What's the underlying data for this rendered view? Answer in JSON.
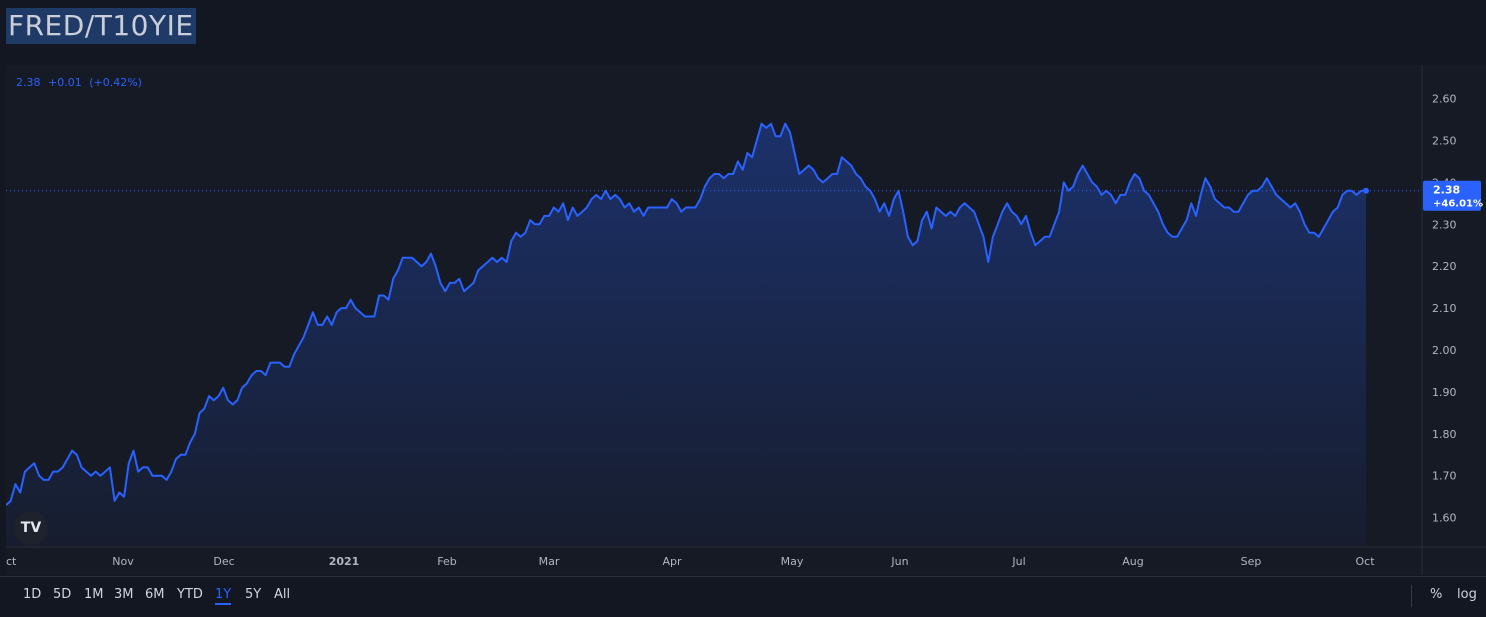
{
  "symbol": "FRED/T10YIE",
  "legend": {
    "value": "2.38",
    "change": "+0.01",
    "change_pct": "(+0.42%)"
  },
  "price_badge": {
    "value": "2.38",
    "pct": "+46.01%"
  },
  "logo_text": "TV",
  "ranges": [
    "1D",
    "5D",
    "1M",
    "3M",
    "6M",
    "YTD",
    "1Y",
    "5Y",
    "All"
  ],
  "active_range": "1Y",
  "scale_buttons": {
    "percent": "%",
    "log": "log"
  },
  "colors": {
    "line": "#2962ff",
    "background": "#131722",
    "badge": "#2962ff"
  },
  "chart_data": {
    "type": "area",
    "x_labels": [
      "Oct",
      "Nov",
      "Dec",
      "2021",
      "Feb",
      "Mar",
      "Apr",
      "May",
      "Jun",
      "Jul",
      "Aug",
      "Sep",
      "Oct"
    ],
    "x_label_shown_first": "ct",
    "y_ticks": [
      1.6,
      1.7,
      1.8,
      1.9,
      2.0,
      2.1,
      2.2,
      2.3,
      2.4,
      2.5,
      2.6
    ],
    "ylim": [
      1.53,
      2.68
    ],
    "current_value": 2.38,
    "grid": false,
    "values": [
      1.63,
      1.64,
      1.68,
      1.66,
      1.71,
      1.72,
      1.73,
      1.7,
      1.69,
      1.69,
      1.71,
      1.71,
      1.72,
      1.74,
      1.76,
      1.75,
      1.72,
      1.71,
      1.7,
      1.71,
      1.7,
      1.71,
      1.72,
      1.64,
      1.66,
      1.65,
      1.73,
      1.76,
      1.71,
      1.72,
      1.72,
      1.7,
      1.7,
      1.7,
      1.69,
      1.71,
      1.74,
      1.75,
      1.75,
      1.78,
      1.8,
      1.85,
      1.86,
      1.89,
      1.88,
      1.89,
      1.91,
      1.88,
      1.87,
      1.88,
      1.91,
      1.92,
      1.94,
      1.95,
      1.95,
      1.94,
      1.97,
      1.97,
      1.97,
      1.96,
      1.96,
      1.99,
      2.01,
      2.03,
      2.06,
      2.09,
      2.06,
      2.06,
      2.08,
      2.06,
      2.09,
      2.1,
      2.1,
      2.12,
      2.1,
      2.09,
      2.08,
      2.08,
      2.08,
      2.13,
      2.13,
      2.12,
      2.17,
      2.19,
      2.22,
      2.22,
      2.22,
      2.21,
      2.2,
      2.21,
      2.23,
      2.2,
      2.16,
      2.14,
      2.16,
      2.16,
      2.17,
      2.14,
      2.15,
      2.16,
      2.19,
      2.2,
      2.21,
      2.22,
      2.21,
      2.22,
      2.21,
      2.26,
      2.28,
      2.27,
      2.28,
      2.31,
      2.3,
      2.3,
      2.32,
      2.32,
      2.34,
      2.33,
      2.35,
      2.31,
      2.34,
      2.32,
      2.33,
      2.34,
      2.36,
      2.37,
      2.36,
      2.38,
      2.36,
      2.37,
      2.36,
      2.34,
      2.35,
      2.33,
      2.34,
      2.32,
      2.34,
      2.34,
      2.34,
      2.34,
      2.34,
      2.36,
      2.35,
      2.33,
      2.34,
      2.34,
      2.34,
      2.36,
      2.39,
      2.41,
      2.42,
      2.42,
      2.41,
      2.42,
      2.42,
      2.45,
      2.43,
      2.47,
      2.46,
      2.5,
      2.54,
      2.53,
      2.54,
      2.51,
      2.51,
      2.54,
      2.52,
      2.47,
      2.42,
      2.43,
      2.44,
      2.43,
      2.41,
      2.4,
      2.41,
      2.42,
      2.42,
      2.46,
      2.45,
      2.44,
      2.42,
      2.41,
      2.39,
      2.38,
      2.36,
      2.33,
      2.35,
      2.32,
      2.36,
      2.38,
      2.33,
      2.27,
      2.25,
      2.26,
      2.31,
      2.33,
      2.29,
      2.34,
      2.33,
      2.32,
      2.33,
      2.32,
      2.34,
      2.35,
      2.34,
      2.33,
      2.3,
      2.27,
      2.21,
      2.27,
      2.3,
      2.33,
      2.35,
      2.33,
      2.32,
      2.3,
      2.32,
      2.28,
      2.25,
      2.26,
      2.27,
      2.27,
      2.3,
      2.33,
      2.4,
      2.38,
      2.39,
      2.42,
      2.44,
      2.42,
      2.4,
      2.39,
      2.37,
      2.38,
      2.37,
      2.35,
      2.37,
      2.37,
      2.4,
      2.42,
      2.41,
      2.38,
      2.37,
      2.35,
      2.33,
      2.3,
      2.28,
      2.27,
      2.27,
      2.29,
      2.31,
      2.35,
      2.32,
      2.37,
      2.41,
      2.39,
      2.36,
      2.35,
      2.34,
      2.34,
      2.33,
      2.33,
      2.35,
      2.37,
      2.38,
      2.38,
      2.39,
      2.41,
      2.39,
      2.37,
      2.36,
      2.35,
      2.34,
      2.35,
      2.33,
      2.3,
      2.28,
      2.28,
      2.27,
      2.29,
      2.31,
      2.33,
      2.34,
      2.37,
      2.38,
      2.38,
      2.37,
      2.38,
      2.38
    ]
  }
}
